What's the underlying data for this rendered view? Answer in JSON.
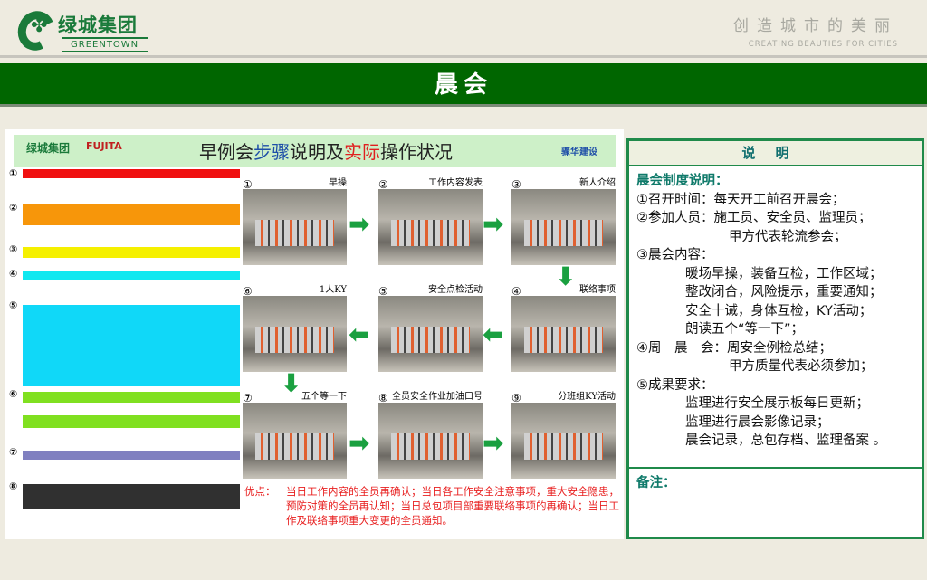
{
  "header": {
    "logo_cn": "绿城集团",
    "logo_en": "GREENTOWN",
    "slogan_cn": "创造城市的美丽",
    "slogan_en": "CREATING BEAUTIES FOR CITIES",
    "title": "晨会"
  },
  "figure": {
    "logo_greentown": "绿城集团",
    "logo_fujita": "FUJITA",
    "logo_contractor": "骤华建设",
    "title_a": "早例会",
    "title_b": "步骤",
    "title_c": "说明及",
    "title_d": "实际",
    "title_e": "操作状况",
    "steps": [
      {
        "n": "①",
        "label": "早操"
      },
      {
        "n": "②",
        "label": "工作内容发表"
      },
      {
        "n": "③",
        "label": "新人介绍"
      },
      {
        "n": "⑥",
        "label": "1人KY"
      },
      {
        "n": "⑤",
        "label": "安全点检活动"
      },
      {
        "n": "④",
        "label": "联络事项"
      },
      {
        "n": "⑦",
        "label": "五个等一下"
      },
      {
        "n": "⑧",
        "label": "全员安全作业加油口号"
      },
      {
        "n": "⑨",
        "label": "分班组KY活动"
      }
    ],
    "side_nums": [
      "①",
      "②",
      "③",
      "④",
      "⑤",
      "⑥",
      "⑦",
      "⑧"
    ],
    "merit_label": "优点：",
    "merit_text": "当日工作内容的全员再确认；当日各工作安全注意事项，重大安全隐患，预防对策的全员再认知；当日总包项目部重要联络事项的再确认；当日工作及联络事项重大变更的全员通知。"
  },
  "panel": {
    "title": "说明",
    "subtitle": "晨会制度说明：",
    "lines": [
      "①召开时间：每天开工前召开晨会；",
      "②参加人员：施工员、安全员、监理员；",
      "甲方代表轮流参会；",
      "③晨会内容：",
      "暖场早操，装备互检，工作区域；",
      "整改闭合，风险提示，重要通知；",
      "安全十诫，身体互检，KY活动；",
      "朗读五个“等一下”；",
      "④周　晨　会：周安全例检总结；",
      "甲方质量代表必须参加；",
      "⑤成果要求：",
      "监理进行安全展示板每日更新；",
      "监理进行晨会影像记录；",
      "晨会记录，总包存档、监理备案 。"
    ],
    "note_label": "备注："
  }
}
